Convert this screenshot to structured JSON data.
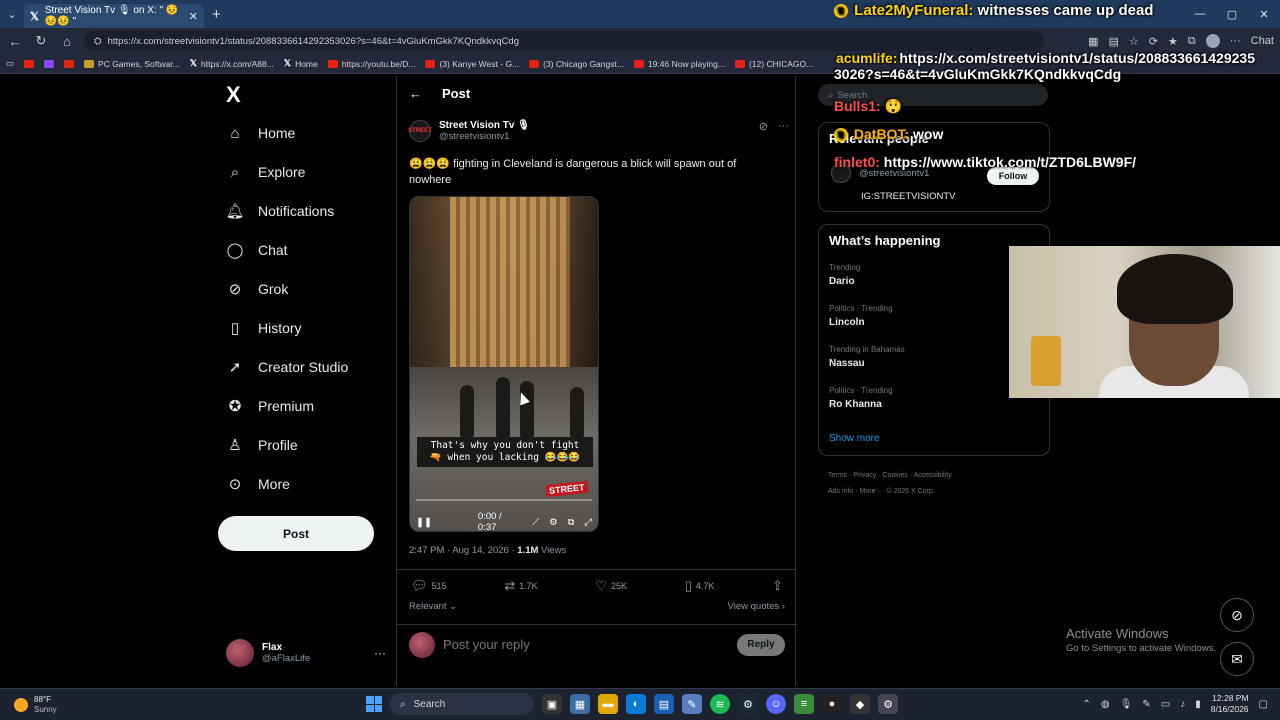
{
  "browser": {
    "tab_title": "Street Vision Tv 🎙 on X: \" 😣😣😣 \"",
    "url": "https://x.com/streetvisiontv1/status/2088336614292353026?s=46&t=4vGluKmGkk7KQndkkvqCdg",
    "bookmarks": [
      {
        "icon": "youtube-icon",
        "label": ""
      },
      {
        "icon": "twitch-icon",
        "label": ""
      },
      {
        "icon": "youtube-icon",
        "label": ""
      },
      {
        "icon": "pc-games-icon",
        "label": "PC Games, Softwar..."
      },
      {
        "icon": "x-icon",
        "label": "https://x.com/A88..."
      },
      {
        "icon": "x-icon",
        "label": "Home"
      },
      {
        "icon": "youtube-icon",
        "label": "https://youtu.be/D..."
      },
      {
        "icon": "youtube-icon",
        "label": "(3) Kanye West - G..."
      },
      {
        "icon": "youtube-icon",
        "label": "(3) Chicago Gangst..."
      },
      {
        "icon": "youtube-icon",
        "label": "19:46 Now playing..."
      },
      {
        "icon": "youtube-icon",
        "label": "(12) CHICAGO..."
      }
    ],
    "chat_label": "Chat"
  },
  "nav": {
    "logo": "X",
    "items": [
      {
        "label": "Home",
        "icon": "home-icon"
      },
      {
        "label": "Explore",
        "icon": "search-icon"
      },
      {
        "label": "Notifications",
        "icon": "bell-icon"
      },
      {
        "label": "Chat",
        "icon": "chat-icon"
      },
      {
        "label": "Grok",
        "icon": "grok-icon"
      },
      {
        "label": "History",
        "icon": "bookmark-icon"
      },
      {
        "label": "Creator Studio",
        "icon": "rocket-icon"
      },
      {
        "label": "Premium",
        "icon": "verified-icon"
      },
      {
        "label": "Profile",
        "icon": "person-icon"
      },
      {
        "label": "More",
        "icon": "more-icon"
      }
    ],
    "post_button": "Post",
    "user": {
      "name": "Flax",
      "handle": "@aFlaxLife"
    }
  },
  "post": {
    "header": "Post",
    "author_name": "Street Vision Tv 🎙",
    "author_handle": "@streetvisiontv1",
    "text": "😩😩😩 fighting in Cleveland is dangerous a blick will spawn out of nowhere",
    "video": {
      "caption_line1": "That's why you don't fight",
      "caption_line2": "🔫 when you lacking 😂😂😂",
      "watermark": "STREET",
      "time": "0:00 / 0:37",
      "progress_fraction": 0.0
    },
    "timestamp": "2:47 PM · Aug 14, 2026 ·",
    "views_count": "1.1M",
    "views_label": "Views",
    "stats": {
      "replies": "515",
      "reposts": "1.7K",
      "likes": "25K",
      "bookmarks": "4.7K"
    },
    "sort_label": "Relevant",
    "view_quotes": "View quotes",
    "reply_placeholder": "Post your reply",
    "reply_button": "Reply"
  },
  "right": {
    "search_placeholder": "Search",
    "relevant_title": "Relevant people",
    "relevant_handle": "@streetvisiontv1",
    "relevant_bio": "IG:STREETVISIONTV",
    "follow_button": "Follow",
    "whats_happening": "What’s happening",
    "trends": [
      {
        "context": "Trending",
        "name": "Dario"
      },
      {
        "context": "Politics · Trending",
        "name": "Lincoln"
      },
      {
        "context": "Trending in Bahamas",
        "name": "Nassau"
      },
      {
        "context": "Politics · Trending",
        "name": "Ro Khanna"
      }
    ],
    "show_more": "Show more",
    "footer_line1": "Terms  ·  Privacy  ·  Cookies  ·  Accessibility  ·",
    "footer_line2": "Ads info  ·  More ···  © 2026 X Corp."
  },
  "overlay": {
    "msg1_name": "Late2MyFuneral:",
    "msg1_text": "witnesses came up dead",
    "msg2_name": "acumlife:",
    "msg2_text_line1": "https://x.com/streetvisiontv1/status/208833661429235",
    "msg2_text_line2": "3026?s=46&t=4vGluKmGkk7KQndkkvqCdg",
    "msg3_name": "Bulls1:",
    "msg3_text": "😲",
    "msg4_name": "DatBOT:",
    "msg4_text": "wow",
    "msg5_name": "finlet0:",
    "msg5_text": "https://www.tiktok.com/t/ZTD6LBW9F/"
  },
  "windows": {
    "activate_title": "Activate Windows",
    "activate_sub": "Go to Settings to activate Windows.",
    "weather_temp": "88°F",
    "weather_cond": "Sunny",
    "search_label": "Search",
    "time": "12:28 PM",
    "date": "8/16/2026"
  }
}
